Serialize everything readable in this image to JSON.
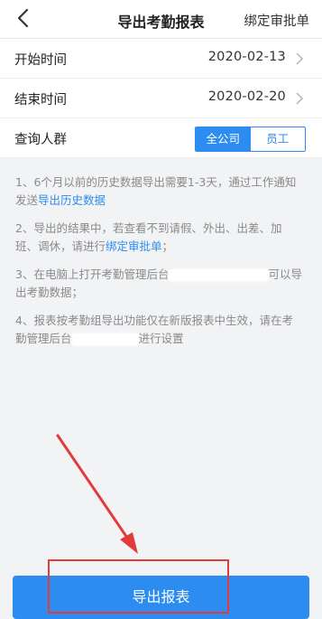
{
  "header": {
    "title": "导出考勤报表",
    "right_link": "绑定审批单"
  },
  "rows": {
    "start": {
      "label": "开始时间",
      "value": "2020-02-13"
    },
    "end": {
      "label": "结束时间",
      "value": "2020-02-20"
    },
    "group": {
      "label": "查询人群",
      "options": [
        "全公司",
        "员工"
      ],
      "selected": "全公司"
    }
  },
  "notes": {
    "n1_a": "1、6个月以前的历史数据导出需要1-3天，通过工作通知发送",
    "n1_link": "导出历史数据",
    "n2_a": "2、导出的结果中，若查看不到请假、外出、出差、加班、调休，请进行",
    "n2_link": "绑定审批单",
    "n2_b": "；",
    "n3_a": "3、在电脑上打开考勤管理后台",
    "n3_b": "可以导出考勤数据；",
    "n4_a": "4、报表按考勤组导出功能仅在新版报表中生效，请在考勤管理后台",
    "n4_b": "进行设置"
  },
  "footer": {
    "button_label": "导出报表"
  },
  "colors": {
    "accent": "#2d8cf0",
    "highlight": "#e23b3b"
  }
}
